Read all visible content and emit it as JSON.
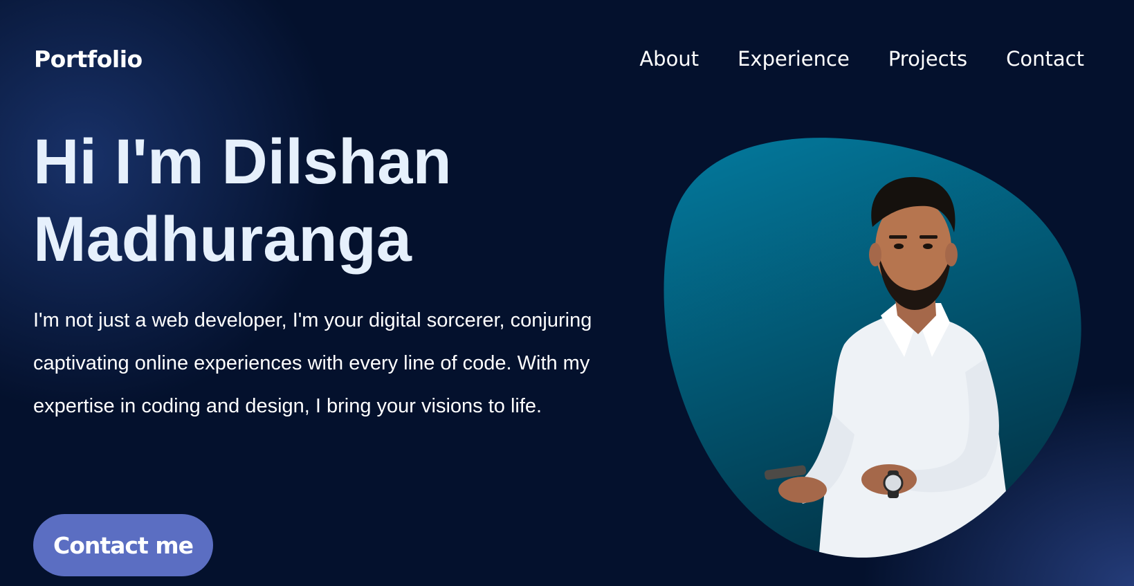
{
  "navbar": {
    "logo": "Portfolio",
    "links": [
      {
        "label": "About"
      },
      {
        "label": "Experience"
      },
      {
        "label": "Projects"
      },
      {
        "label": "Contact"
      }
    ]
  },
  "hero": {
    "title_line1": "Hi I'm Dilshan",
    "title_line2": "Madhuranga",
    "description": "I'm not just a web developer, I'm your digital sorcerer, conjuring captivating online experiences with every line of code. With my expertise in coding and design, I bring your visions to life.",
    "cta_label": "Contact me"
  },
  "colors": {
    "background": "#04112d",
    "accent": "#5b6ec2",
    "title": "#e6f0fc",
    "blob_top": "#037a9e",
    "blob_bottom": "#02384c"
  }
}
